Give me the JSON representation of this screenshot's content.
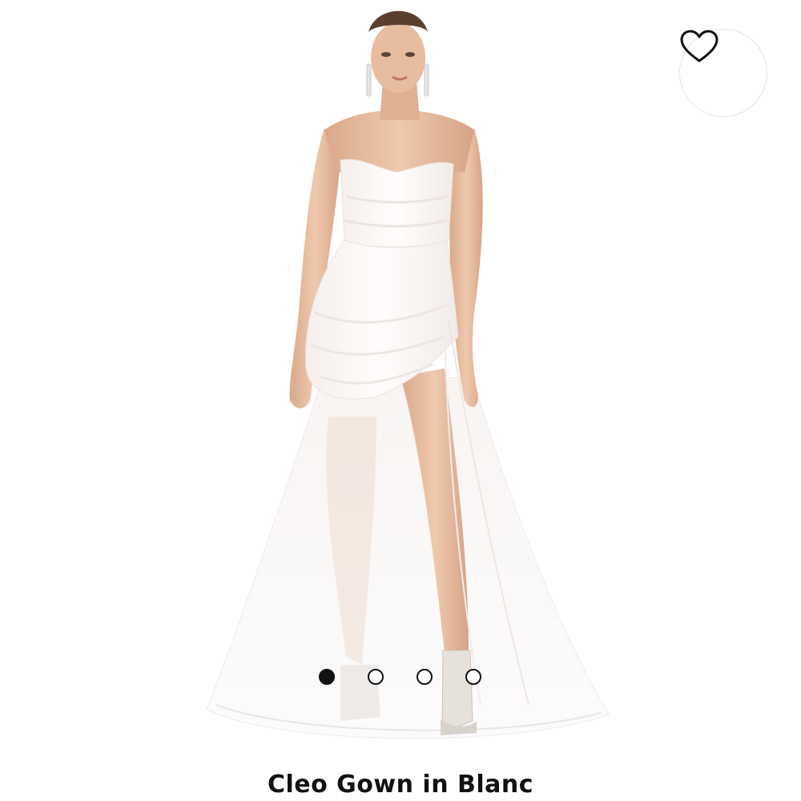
{
  "product": {
    "title": "Cleo Gown in Blanc",
    "image_description": "model wearing a white strapless tulle gown with a high slit and silver heeled sandals"
  },
  "favorite": {
    "icon": "heart-outline-icon",
    "selected": false
  },
  "carousel": {
    "total_slides": 4,
    "active_index": 0
  },
  "colors": {
    "background": "#ffffff",
    "text": "#111111",
    "dot": "#111111",
    "fav_border": "#e3e3e3"
  }
}
